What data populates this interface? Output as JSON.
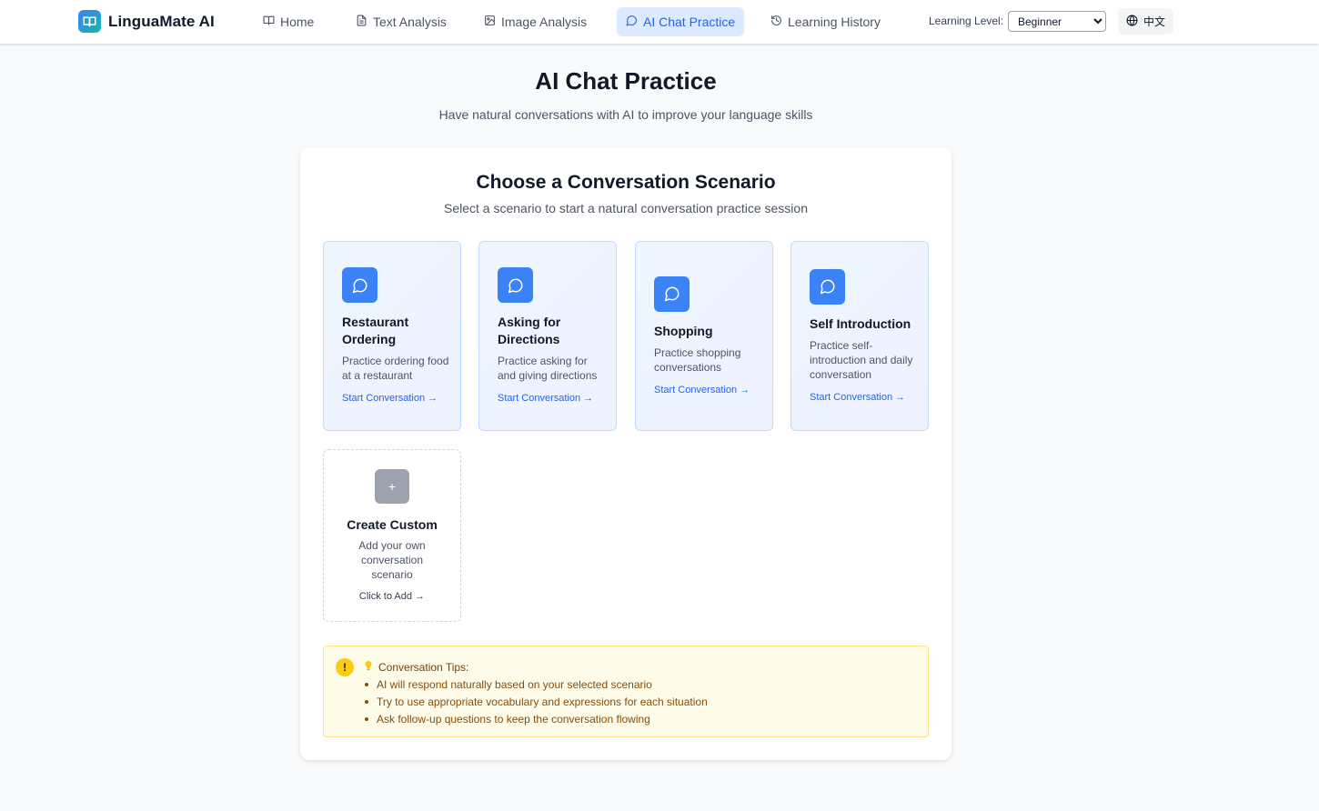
{
  "app": {
    "name": "LinguaMate AI",
    "brand_icon": "open-book-icon"
  },
  "nav": {
    "items": [
      {
        "label": "Home",
        "icon": "book-icon",
        "active": false
      },
      {
        "label": "Text Analysis",
        "icon": "document-icon",
        "active": false
      },
      {
        "label": "Image Analysis",
        "icon": "image-icon",
        "active": false
      },
      {
        "label": "AI Chat Practice",
        "icon": "chat-bubble-icon",
        "active": true
      },
      {
        "label": "Learning History",
        "icon": "history-icon",
        "active": false
      }
    ],
    "level_label": "Learning Level:",
    "level_value": "Beginner",
    "level_options": [
      "Beginner"
    ],
    "language_button": "中文",
    "language_icon": "globe-icon"
  },
  "header": {
    "title": "AI Chat Practice",
    "subtitle": "Have natural conversations with AI to improve your language skills"
  },
  "panel": {
    "title": "Choose a Conversation Scenario",
    "subtitle": "Select a scenario to start a natural conversation practice session",
    "scenarios": [
      {
        "title": "Restaurant Ordering",
        "description": "Practice ordering food at a restaurant",
        "link": "Start Conversation →",
        "icon": "chat-bubble-icon"
      },
      {
        "title": "Asking for Directions",
        "description": "Practice asking for and giving directions",
        "link": "Start Conversation →",
        "icon": "chat-bubble-icon"
      },
      {
        "title": "Shopping",
        "description": "Practice shopping conversations",
        "link": "Start Conversation →",
        "icon": "chat-bubble-icon"
      },
      {
        "title": "Self Introduction",
        "description": "Practice self-introduction and daily conversation",
        "link": "Start Conversation →",
        "icon": "chat-bubble-icon"
      }
    ],
    "custom": {
      "icon_glyph": "+",
      "title": "Create Custom",
      "description": "Add your own conversation scenario",
      "link": "Click to Add →"
    }
  },
  "tips": {
    "icon_glyph": "!",
    "title": "Conversation Tips:",
    "items": [
      "AI will respond naturally based on your selected scenario",
      "Try to use appropriate vocabulary and expressions for each situation",
      "Ask follow-up questions to keep the conversation flowing"
    ]
  },
  "colors": {
    "accent": "#3b82f6",
    "accent_text": "#2563eb",
    "active_nav_bg": "#dbeafe",
    "card_border": "#bfdbfe",
    "tips_bg": "#fefce8",
    "tips_icon": "#facc15"
  }
}
